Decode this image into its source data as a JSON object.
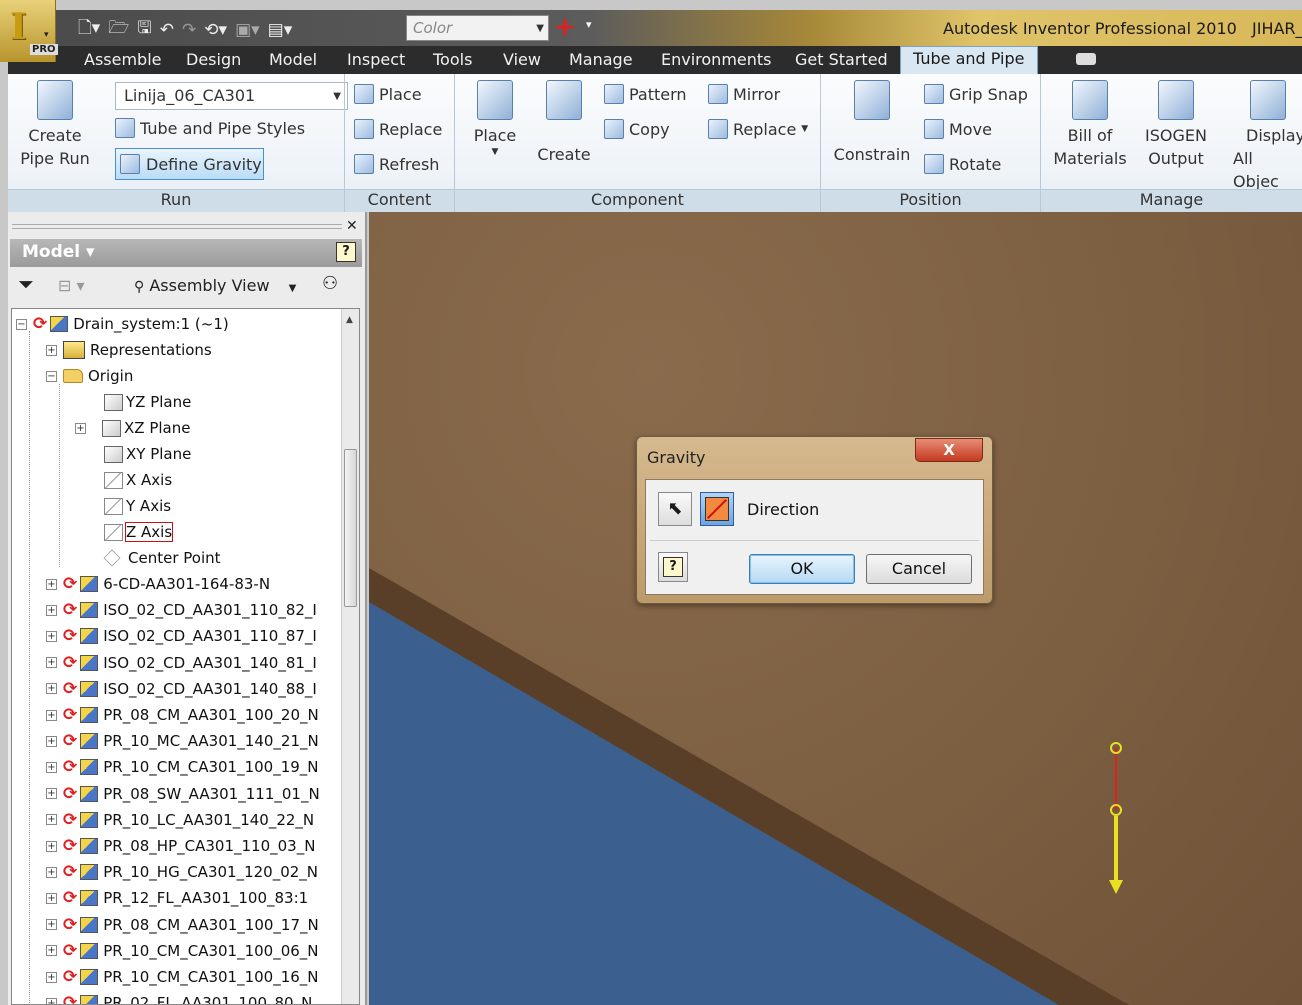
{
  "app": {
    "title": "Autodesk Inventor Professional 2010",
    "user": "JIHAR_",
    "edition": "PRO",
    "logo_letter": "I",
    "color_combo": "Color"
  },
  "tabs": [
    {
      "label": "Assemble"
    },
    {
      "label": "Design"
    },
    {
      "label": "Model"
    },
    {
      "label": "Inspect"
    },
    {
      "label": "Tools"
    },
    {
      "label": "View"
    },
    {
      "label": "Manage"
    },
    {
      "label": "Environments"
    },
    {
      "label": "Get Started"
    },
    {
      "label": "Tube and Pipe"
    }
  ],
  "active_tab": "Tube and Pipe",
  "ribbon": {
    "run": {
      "label": "Run",
      "create_pipe_run_line1": "Create",
      "create_pipe_run_line2": "Pipe Run",
      "run_name": "Linija_06_CA301",
      "tube_and_pipe_styles": "Tube and Pipe Styles",
      "define_gravity": "Define Gravity"
    },
    "content": {
      "label": "Content",
      "place": "Place",
      "replace": "Replace",
      "refresh": "Refresh"
    },
    "component": {
      "label": "Component",
      "place": "Place",
      "create": "Create",
      "pattern": "Pattern",
      "mirror": "Mirror",
      "copy": "Copy",
      "replace": "Replace"
    },
    "position": {
      "label": "Position",
      "constrain": "Constrain",
      "grip_snap": "Grip Snap",
      "move": "Move",
      "rotate": "Rotate"
    },
    "manage": {
      "label": "Manage",
      "bom_line1": "Bill of",
      "bom_line2": "Materials",
      "isogen_line1": "ISOGEN",
      "isogen_line2": "Output",
      "display_line1": "Display",
      "display_line2": "All Objec"
    }
  },
  "browser": {
    "title": "Model",
    "view_mode": "Assembly View",
    "tree": [
      {
        "label": "Drain_system:1 (~1)"
      },
      {
        "label": "Representations"
      },
      {
        "label": "Origin"
      },
      {
        "label": "YZ Plane"
      },
      {
        "label": "XZ Plane"
      },
      {
        "label": "XY Plane"
      },
      {
        "label": "X Axis"
      },
      {
        "label": "Y Axis"
      },
      {
        "label": "Z Axis"
      },
      {
        "label": "Center Point"
      },
      {
        "label": "6-CD-AA301-164-83-N"
      },
      {
        "label": "ISO_02_CD_AA301_110_82_I"
      },
      {
        "label": "ISO_02_CD_AA301_110_87_I"
      },
      {
        "label": "ISO_02_CD_AA301_140_81_I"
      },
      {
        "label": "ISO_02_CD_AA301_140_88_I"
      },
      {
        "label": "PR_08_CM_AA301_100_20_N"
      },
      {
        "label": "PR_10_MC_AA301_140_21_N"
      },
      {
        "label": "PR_10_CM_CA301_100_19_N"
      },
      {
        "label": "PR_08_SW_AA301_111_01_N"
      },
      {
        "label": "PR_10_LC_AA301_140_22_N"
      },
      {
        "label": "PR_08_HP_CA301_110_03_N"
      },
      {
        "label": "PR_10_HG_CA301_120_02_N"
      },
      {
        "label": "PR_12_FL_AA301_100_83:1"
      },
      {
        "label": "PR_08_CM_AA301_100_17_N"
      },
      {
        "label": "PR_10_CM_CA301_100_06_N"
      },
      {
        "label": "PR_10_CM_CA301_100_16_N"
      },
      {
        "label": "PR_02_FL_AA301_100_80_N"
      }
    ]
  },
  "dialog": {
    "title": "Gravity",
    "direction_label": "Direction",
    "ok": "OK",
    "cancel": "Cancel",
    "close": "X",
    "help": "?"
  },
  "colors": {
    "ground": "#7b5d40",
    "ground_edge": "#5a3f28",
    "water": "#3b5f8f",
    "gravity_arrow": "#e8e020",
    "gravity_axis": "#e02020"
  }
}
